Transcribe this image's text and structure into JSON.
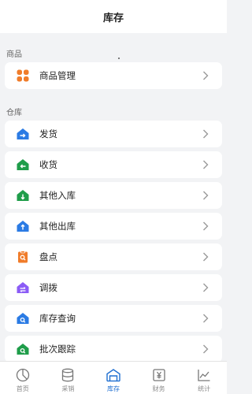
{
  "header": {
    "title": "库存"
  },
  "sections": {
    "goods": {
      "label": "商品"
    },
    "warehouse": {
      "label": "仓库"
    }
  },
  "rows": {
    "goods_management": {
      "label": "商品管理",
      "icon": "grid-icon",
      "color": "#f07c2a"
    },
    "ship": {
      "label": "发货",
      "icon": "house-arrow-right-icon",
      "color": "#2b7be4"
    },
    "receive": {
      "label": "收货",
      "icon": "house-arrow-left-icon",
      "color": "#1f9d4a"
    },
    "other_in": {
      "label": "其他入库",
      "icon": "house-arrow-down-icon",
      "color": "#1f9d4a"
    },
    "other_out": {
      "label": "其他出库",
      "icon": "house-arrow-up-icon",
      "color": "#2b7be4"
    },
    "stocktake": {
      "label": "盘点",
      "icon": "clipboard-search-icon",
      "color": "#f07c2a"
    },
    "transfer": {
      "label": "调拨",
      "icon": "house-transfer-icon",
      "color": "#8b5cf6"
    },
    "stock_query": {
      "label": "库存查询",
      "icon": "house-search-icon",
      "color": "#2b7be4"
    },
    "batch_tracking": {
      "label": "批次跟踪",
      "icon": "house-search-icon",
      "color": "#1f9d4a"
    }
  },
  "tabbar": {
    "items": [
      {
        "label": "首页",
        "icon": "pie-chart-icon"
      },
      {
        "label": "采销",
        "icon": "database-icon"
      },
      {
        "label": "库存",
        "icon": "warehouse-icon",
        "active": true
      },
      {
        "label": "财务",
        "icon": "yen-doc-icon"
      },
      {
        "label": "统计",
        "icon": "line-chart-icon"
      }
    ]
  },
  "colors": {
    "accent": "#1f6fd1",
    "background": "#f2f3f5"
  }
}
